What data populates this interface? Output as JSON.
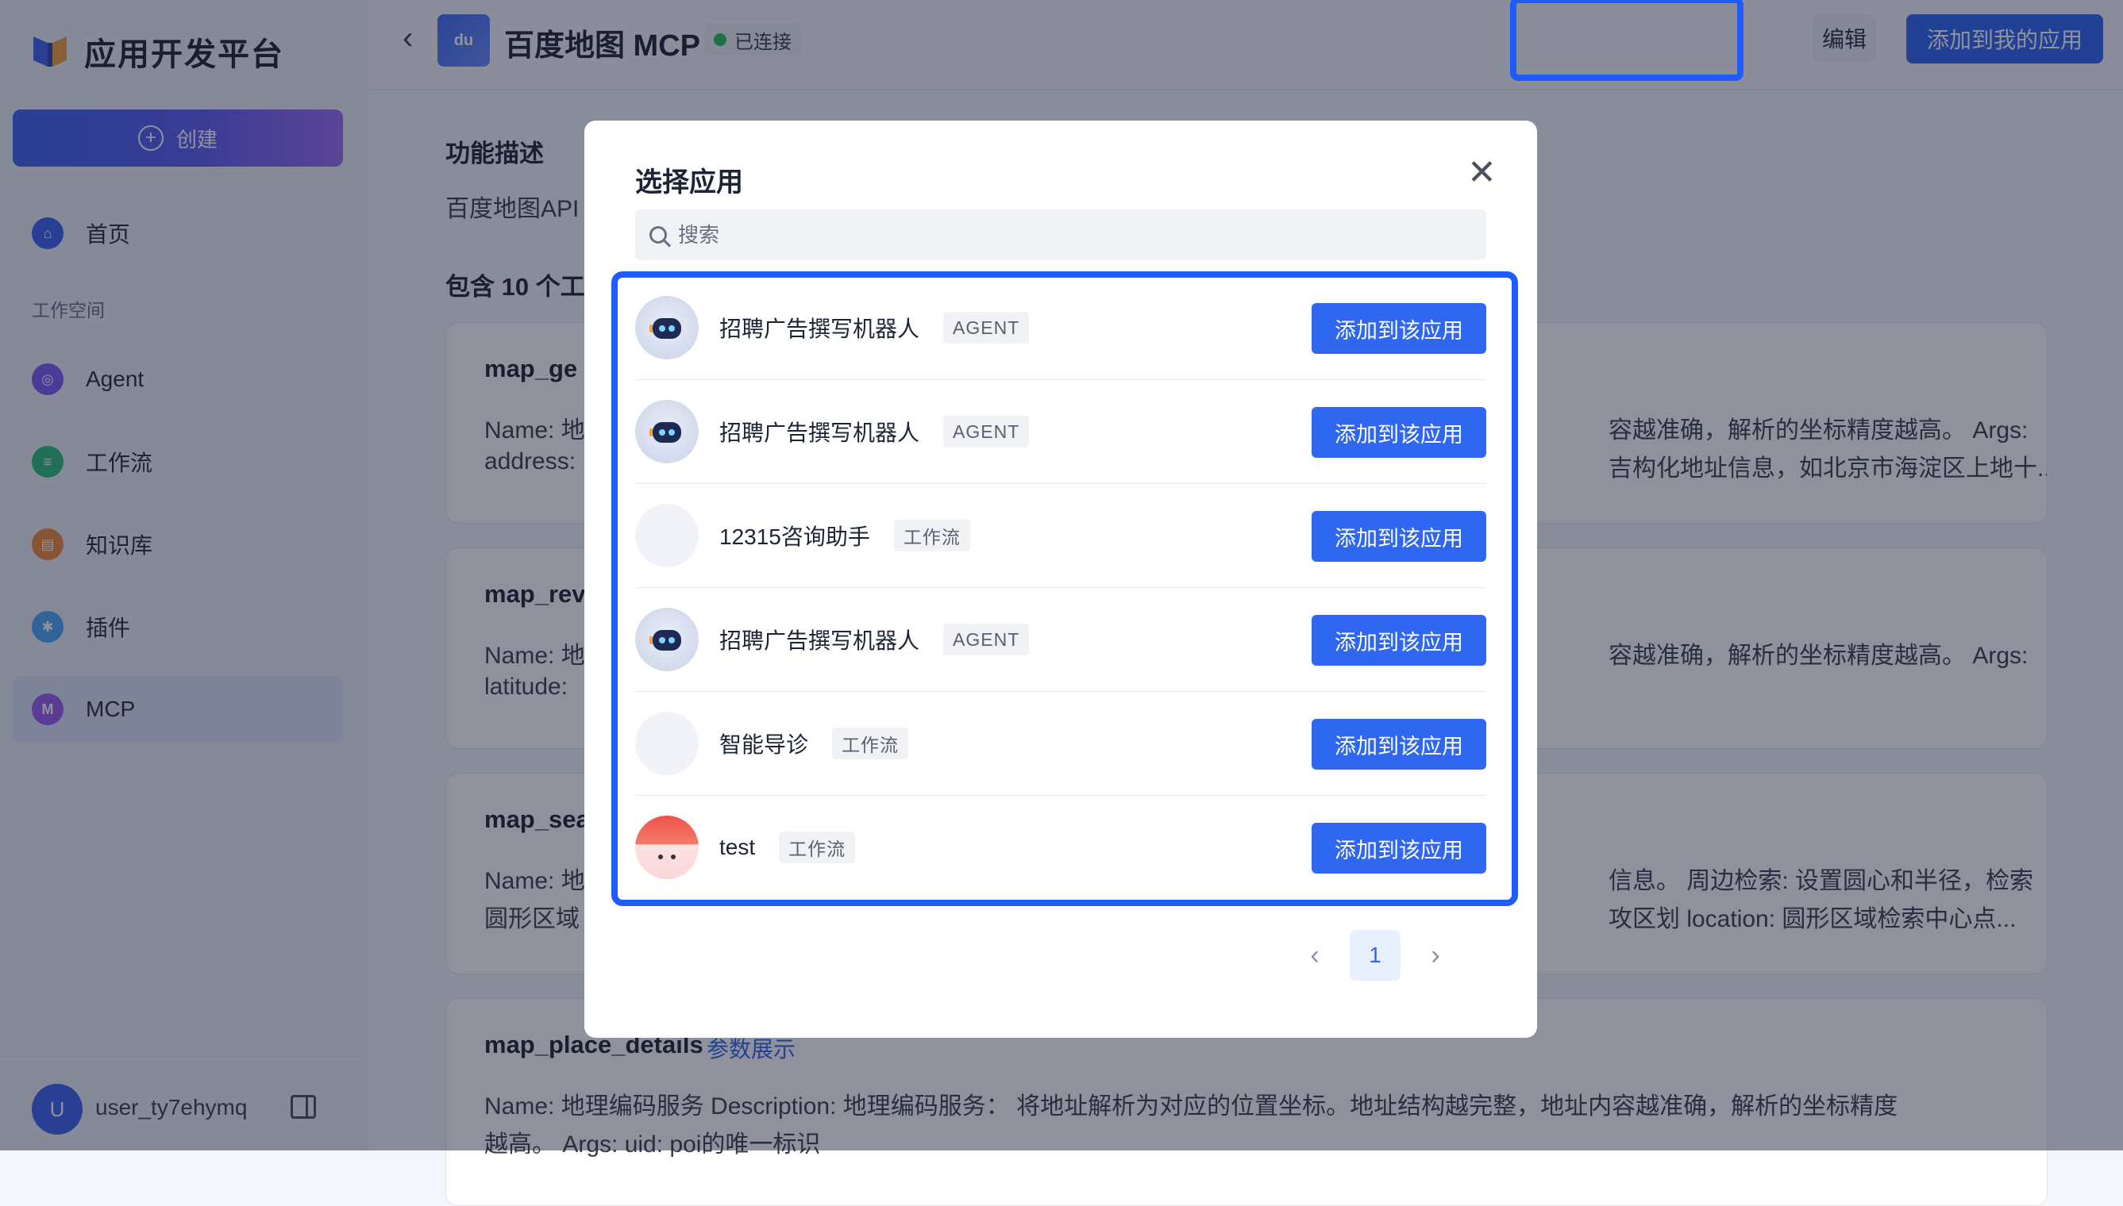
{
  "sidebar": {
    "brand_title": "应用开发平台",
    "create_label": "创建",
    "home_label": "首页",
    "workspace_label": "工作空间",
    "items": [
      {
        "label": "Agent",
        "icon": "agent-icon",
        "color": "#7a5af5"
      },
      {
        "label": "工作流",
        "icon": "workflow-icon",
        "color": "#2bbf7a"
      },
      {
        "label": "知识库",
        "icon": "knowledge-icon",
        "color": "#f08a3c"
      },
      {
        "label": "插件",
        "icon": "plugin-icon",
        "color": "#4aa8f5"
      },
      {
        "label": "MCP",
        "icon": "mcp-icon",
        "color": "#9a5cf0"
      }
    ],
    "active_item": "MCP",
    "user_initial": "U",
    "username": "user_ty7ehymq"
  },
  "header": {
    "back_glyph": "‹",
    "logo_text": "du",
    "title": "百度地图 MCP",
    "status": "已连接",
    "edit_label": "编辑",
    "add_label": "添加到我的应用"
  },
  "main": {
    "desc_title": "功能描述",
    "desc_text": "百度地图API",
    "tools_title": "包含 10 个工",
    "tools": [
      {
        "name": "map_ge",
        "line1": "Name: 地",
        "line2": "address:",
        "right1": "容越准确，解析的坐标精度越高。 Args:",
        "right2": "吉构化地址信息，如北京市海淀区上地十..."
      },
      {
        "name": "map_rev",
        "line1": "Name: 地",
        "line2": "latitude:",
        "right1": "容越准确，解析的坐标精度越高。 Args:",
        "right2": ""
      },
      {
        "name": "map_sea",
        "line1": "Name: 地",
        "line2": "圆形区域",
        "right1": "信息。 周边检索: 设置圆心和半径，检索",
        "right2": "攻区划 location: 圆形区域检索中心点..."
      },
      {
        "name": "map_place_details",
        "link": "参数展示",
        "line1": "Name: 地理编码服务 Description: 地理编码服务： 将地址解析为对应的位置坐标。地址结构越完整，地址内容越准确，解析的坐标精度",
        "line2": "越高。 Args: uid: poi的唯一标识"
      }
    ]
  },
  "modal": {
    "title": "选择应用",
    "close_glyph": "✕",
    "search_placeholder": "搜索",
    "add_label": "添加到该应用",
    "apps": [
      {
        "name": "招聘广告撰写机器人",
        "tag": "AGENT",
        "avatar": "robot"
      },
      {
        "name": "招聘广告撰写机器人",
        "tag": "AGENT",
        "avatar": "robot"
      },
      {
        "name": "12315咨询助手",
        "tag": "工作流",
        "avatar": "blank"
      },
      {
        "name": "招聘广告撰写机器人",
        "tag": "AGENT",
        "avatar": "robot"
      },
      {
        "name": "智能导诊",
        "tag": "工作流",
        "avatar": "blank"
      },
      {
        "name": "test",
        "tag": "工作流",
        "avatar": "pink"
      }
    ],
    "pagination": {
      "prev": "‹",
      "current": "1",
      "next": "›"
    }
  }
}
